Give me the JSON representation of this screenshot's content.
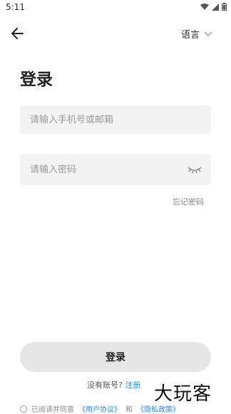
{
  "status_bar": {
    "time": "5:11"
  },
  "header": {
    "language_label": "语言"
  },
  "page": {
    "title": "登录"
  },
  "form": {
    "account_placeholder": "请输入手机号或邮箱",
    "password_placeholder": "请输入密码",
    "forgot_label": "忘记密码",
    "login_label": "登录"
  },
  "register": {
    "prompt": "没有账号?",
    "link": "注册"
  },
  "agreement": {
    "prefix": "已阅读并同意",
    "terms": "《用户协议》",
    "and": "和",
    "privacy": "《隐私政策》"
  },
  "watermark": {
    "text": "大玩客"
  },
  "colors": {
    "link": "#2b8be6",
    "button_bg": "#e6e6e6",
    "input_bg": "#f3f3f3"
  }
}
